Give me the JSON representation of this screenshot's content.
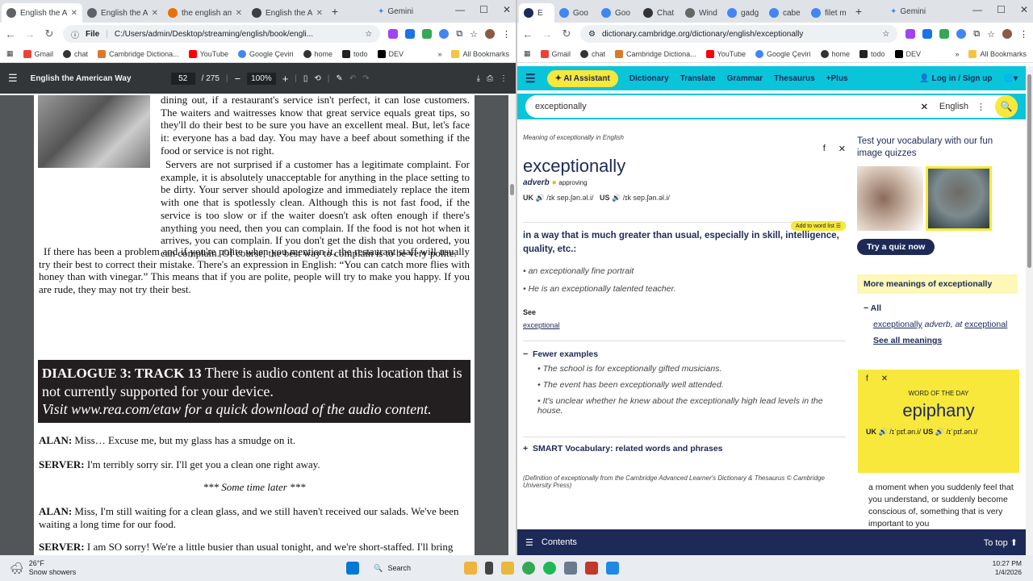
{
  "left": {
    "tabs": [
      {
        "title": "English the Am",
        "active": true,
        "color": "#5f6368"
      },
      {
        "title": "English the Am",
        "active": false,
        "color": "#5f6368"
      },
      {
        "title": "the english am",
        "active": false,
        "color": "#e8710a"
      },
      {
        "title": "English the Am",
        "active": false,
        "color": "#3c4043"
      }
    ],
    "gemini": "Gemini",
    "file_label": "File",
    "url": "C:/Users/admin/Desktop/streaming/english/book/engli...",
    "bookmarks": [
      "Gmail",
      "chat",
      "Cambridge Dictiona...",
      "YouTube",
      "Google Çeviri",
      "home",
      "todo",
      "DEV"
    ],
    "all_bookmarks": "All Bookmarks",
    "pdf": {
      "title": "English the American Way",
      "page": "52",
      "total": "/ 275",
      "zoom": "100%"
    }
  },
  "book": {
    "para1": "dining out, if a restaurant's service isn't perfect, it can lose customers. The waiters and waitresses know that great service equals great tips, so they'll do their best to be sure you have an excellent meal. But, let's face it: everyone has a bad day. You may have a beef about something if the food or service is not right.",
    "para2": "Servers are not surprised if a customer has a legitimate complaint. For example, it is absolutely unacceptable for anything in the place setting to be dirty. Your server should apologize and immediately replace the item with one that is spotlessly clean. Although this is not fast food, if the service is too slow or if the waiter doesn't ask often enough if there's anything you need, then you can complain. If the food is not hot when it arrives, you can complain. If you don't get the dish that you ordered, you can complain. Of course, the best way to complain is to be very polite.",
    "para3": "If there has been a problem and if you're polite when you mention it, the restaurant staff will usually try their best to correct their mistake. There's an expression in English: “You can catch more flies with honey than with vinegar.” This means that if you are polite, people will try to make you happy. If you are rude, they may not try their best.",
    "dlg_title": "DIALOGUE 3: TRACK 13",
    "dlg_text": "There is audio content at this location that is not currently supported for your device.",
    "dlg_link": "Visit www.rea.com/etaw for a quick download of the audio content.",
    "l1_spk": "ALAN:",
    "l1": "Miss… Excuse me, but my glass has a smudge on it.",
    "l2_spk": "SERVER:",
    "l2": "I'm terribly sorry sir. I'll get you a clean one right away.",
    "l3": "*** Some time later ***",
    "l4_spk": "ALAN:",
    "l4": "Miss, I'm still waiting for a clean glass, and we still haven't received our salads. We've been waiting a long time for our food.",
    "l5_spk": "SERVER:",
    "l5": "I am SO sorry! We're a little busier than usual tonight, and we're short-staffed. I'll bring"
  },
  "right": {
    "tabs": [
      "E",
      "Goo",
      "Goo",
      "Chat",
      "Wind",
      "gadg",
      "cabe",
      "filet m"
    ],
    "gemini": "Gemini",
    "url": "dictionary.cambridge.org/dictionary/english/exceptionally",
    "nav": {
      "ai": "AI Assistant",
      "dictionary": "Dictionary",
      "translate": "Translate",
      "grammar": "Grammar",
      "thesaurus": "Thesaurus",
      "plus": "+Plus",
      "login": "Log in / Sign up"
    },
    "search_value": "exceptionally",
    "lang": "English",
    "meaning_of": "Meaning of exceptionally in English",
    "headword": "exceptionally",
    "pos": "adverb",
    "approving": "approving",
    "uk": "UK",
    "us": "US",
    "ipa_uk": "/ɪk sep.ʃən.əl.i/",
    "ipa_us": "/ɪk sep.ʃən.əl.i/",
    "add_list": "Add to word list",
    "definition": "in a way that is much greater than usual, especially in skill, intelligence, quality, etc.:",
    "examples": [
      "an exceptionally fine portrait",
      "He is an exceptionally talented teacher."
    ],
    "see": "See",
    "see_link": "exceptional",
    "fewer": "Fewer examples",
    "more_examples": [
      "The school is for exceptionally gifted musicians.",
      "The event has been exceptionally well attended.",
      "It's unclear whether he knew about the exceptionally high lead levels in the house."
    ],
    "smart": "SMART Vocabulary: related words and phrases",
    "credit": "(Definition of exceptionally from the Cambridge Advanced Learner's Dictionary & Thesaurus © Cambridge University Press)",
    "quiz_title": "Test your vocabulary with our fun image quizzes",
    "quiz_btn": "Try a quiz now",
    "more_meanings": "More meanings of exceptionally",
    "all": "All",
    "mm_word": "exceptionally",
    "mm_pos": "adverb, at",
    "mm_link": "exceptional",
    "see_all": "See all meanings",
    "wotd_label": "WORD OF THE DAY",
    "wotd": "epiphany",
    "wotd_ipa_uk": "/ɪˈpɪf.ən.i/",
    "wotd_ipa_us": "/ɪˈpɪf.ən.i/",
    "wotd_def": "a moment when you suddenly feel that you understand, or suddenly become conscious of, something that is very important to you",
    "contents": "Contents",
    "totop": "To top"
  },
  "taskbar": {
    "temp": "26°F",
    "weather": "Snow showers",
    "search": "Search",
    "time": "10:27 PM",
    "date": "1/4/2026"
  }
}
